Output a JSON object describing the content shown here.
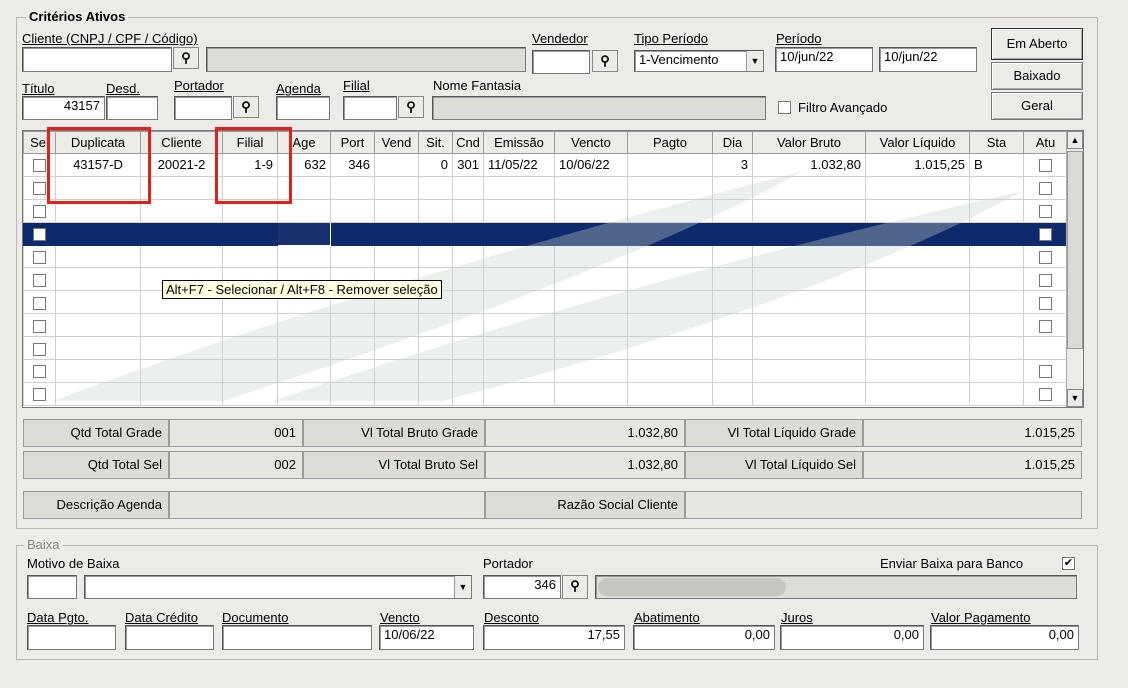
{
  "criteria": {
    "group_title": "Critérios Ativos",
    "cliente_label": "Cliente (CNPJ / CPF / Código)",
    "cliente_value": "",
    "vendedor_label": "Vendedor",
    "vendedor_value": "",
    "tipo_periodo_label": "Tipo Período",
    "tipo_periodo_value": "1-Vencimento",
    "periodo_label": "Período",
    "periodo_from": "10/jun/22",
    "periodo_to": "10/jun/22",
    "titulo_label": "Título",
    "titulo_value": "43157",
    "desd_label": "Desd.",
    "portador_label": "Portador",
    "agenda_label": "Agenda",
    "filial_label": "Filial",
    "nome_fantasia_label": "Nome Fantasia",
    "filtro_avancado_label": "Filtro Avançado",
    "btn_em_aberto": "Em Aberto",
    "btn_baixado": "Baixado",
    "btn_geral": "Geral"
  },
  "grid": {
    "columns": [
      "Sel",
      "Duplicata",
      "Cliente",
      "Filial",
      "Age",
      "Port",
      "Vend",
      "Sit.",
      "Cnd",
      "Emissão",
      "Vencto",
      "Pagto",
      "Dia",
      "Valor Bruto",
      "Valor Líquido",
      "Sta",
      "Atu"
    ],
    "row1": {
      "duplicata": "43157-D",
      "cliente": "20021-2",
      "filial": "1-9",
      "age": "632",
      "port": "346",
      "vend": "",
      "sit": "0",
      "cnd": "301",
      "emissao": "11/05/22",
      "vencto": "10/06/22",
      "pagto": "",
      "dia": "3",
      "valor_bruto": "1.032,80",
      "valor_liquido": "1.015,25",
      "sta": "B"
    },
    "tooltip": "Alt+F7 - Selecionar / Alt+F8 - Remover seleção"
  },
  "totals": {
    "qtd_total_grade_label": "Qtd Total Grade",
    "qtd_total_grade": "001",
    "vl_total_bruto_grade_label": "Vl Total Bruto Grade",
    "vl_total_bruto_grade": "1.032,80",
    "vl_total_liquido_grade_label": "Vl Total Líquido Grade",
    "vl_total_liquido_grade": "1.015,25",
    "qtd_total_sel_label": "Qtd Total Sel",
    "qtd_total_sel": "002",
    "vl_total_bruto_sel_label": "Vl Total Bruto Sel",
    "vl_total_bruto_sel": "1.032,80",
    "vl_total_liquido_sel_label": "Vl Total Líquido Sel",
    "vl_total_liquido_sel": "1.015,25",
    "descricao_agenda_label": "Descrição Agenda",
    "razao_social_label": "Razão Social Cliente"
  },
  "baixa": {
    "group_title": "Baixa",
    "motivo_label": "Motivo de Baixa",
    "portador_label": "Portador",
    "portador_value": "346",
    "enviar_label": "Enviar Baixa para Banco",
    "enviar_checked": "✔",
    "data_pgto_label": "Data Pgto.",
    "data_credito_label": "Data Crédito",
    "documento_label": "Documento",
    "vencto_label": "Vencto",
    "vencto_value": "10/06/22",
    "desconto_label": "Desconto",
    "desconto_value": "17,55",
    "abatimento_label": "Abatimento",
    "abatimento_value": "0,00",
    "juros_label": "Juros",
    "juros_value": "0,00",
    "valor_pagamento_label": "Valor Pagamento",
    "valor_pagamento_value": "0,00"
  },
  "icons": {
    "binoculars": "🔭",
    "dropdown": "▼",
    "scroll_up": "▲"
  }
}
